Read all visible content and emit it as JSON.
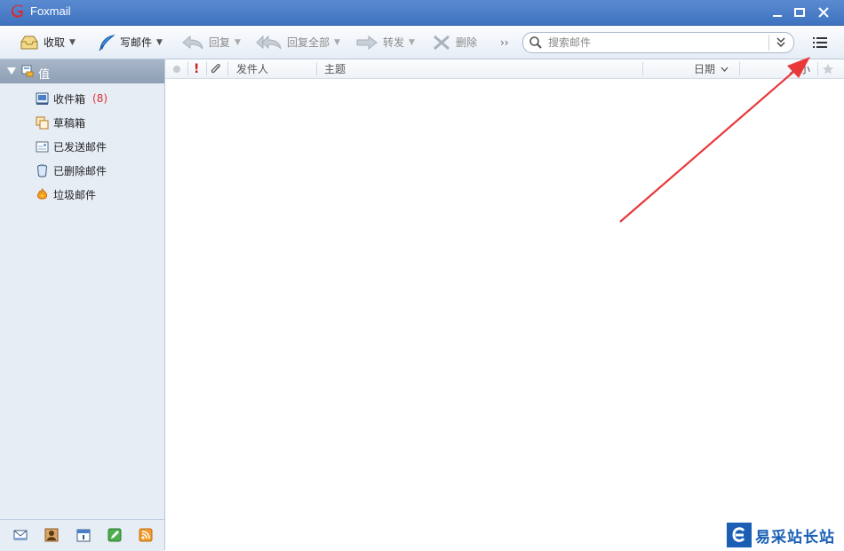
{
  "window": {
    "title": "Foxmail"
  },
  "toolbar": {
    "receive_label": "收取",
    "compose_label": "写邮件",
    "reply_label": "回复",
    "reply_all_label": "回复全部",
    "forward_label": "转发",
    "delete_label": "删除",
    "more_label": "››"
  },
  "search": {
    "placeholder": "搜索邮件"
  },
  "sidebar": {
    "account": "值",
    "folders": [
      {
        "label": "收件箱",
        "count": "(8)",
        "icon": "inbox-icon"
      },
      {
        "label": "草稿箱",
        "icon": "drafts-icon"
      },
      {
        "label": "已发送邮件",
        "icon": "sent-icon"
      },
      {
        "label": "已删除邮件",
        "icon": "trash-icon"
      },
      {
        "label": "垃圾邮件",
        "icon": "junk-icon"
      }
    ],
    "bottom_icons": [
      "mail-icon",
      "contacts-icon",
      "calendar-icon",
      "notes-icon",
      "rss-icon"
    ]
  },
  "list_header": {
    "important": "!",
    "sender": "发件人",
    "subject": "主题",
    "date": "日期",
    "size": "大小"
  },
  "watermark": {
    "text": "易采站长站"
  },
  "colors": {
    "titlebar": "#4a7fc8",
    "sidebar": "#e7edf5",
    "account_bar": "#98a8bb",
    "unread_count": "#e03030",
    "annotation_arrow": "#e8383a"
  }
}
